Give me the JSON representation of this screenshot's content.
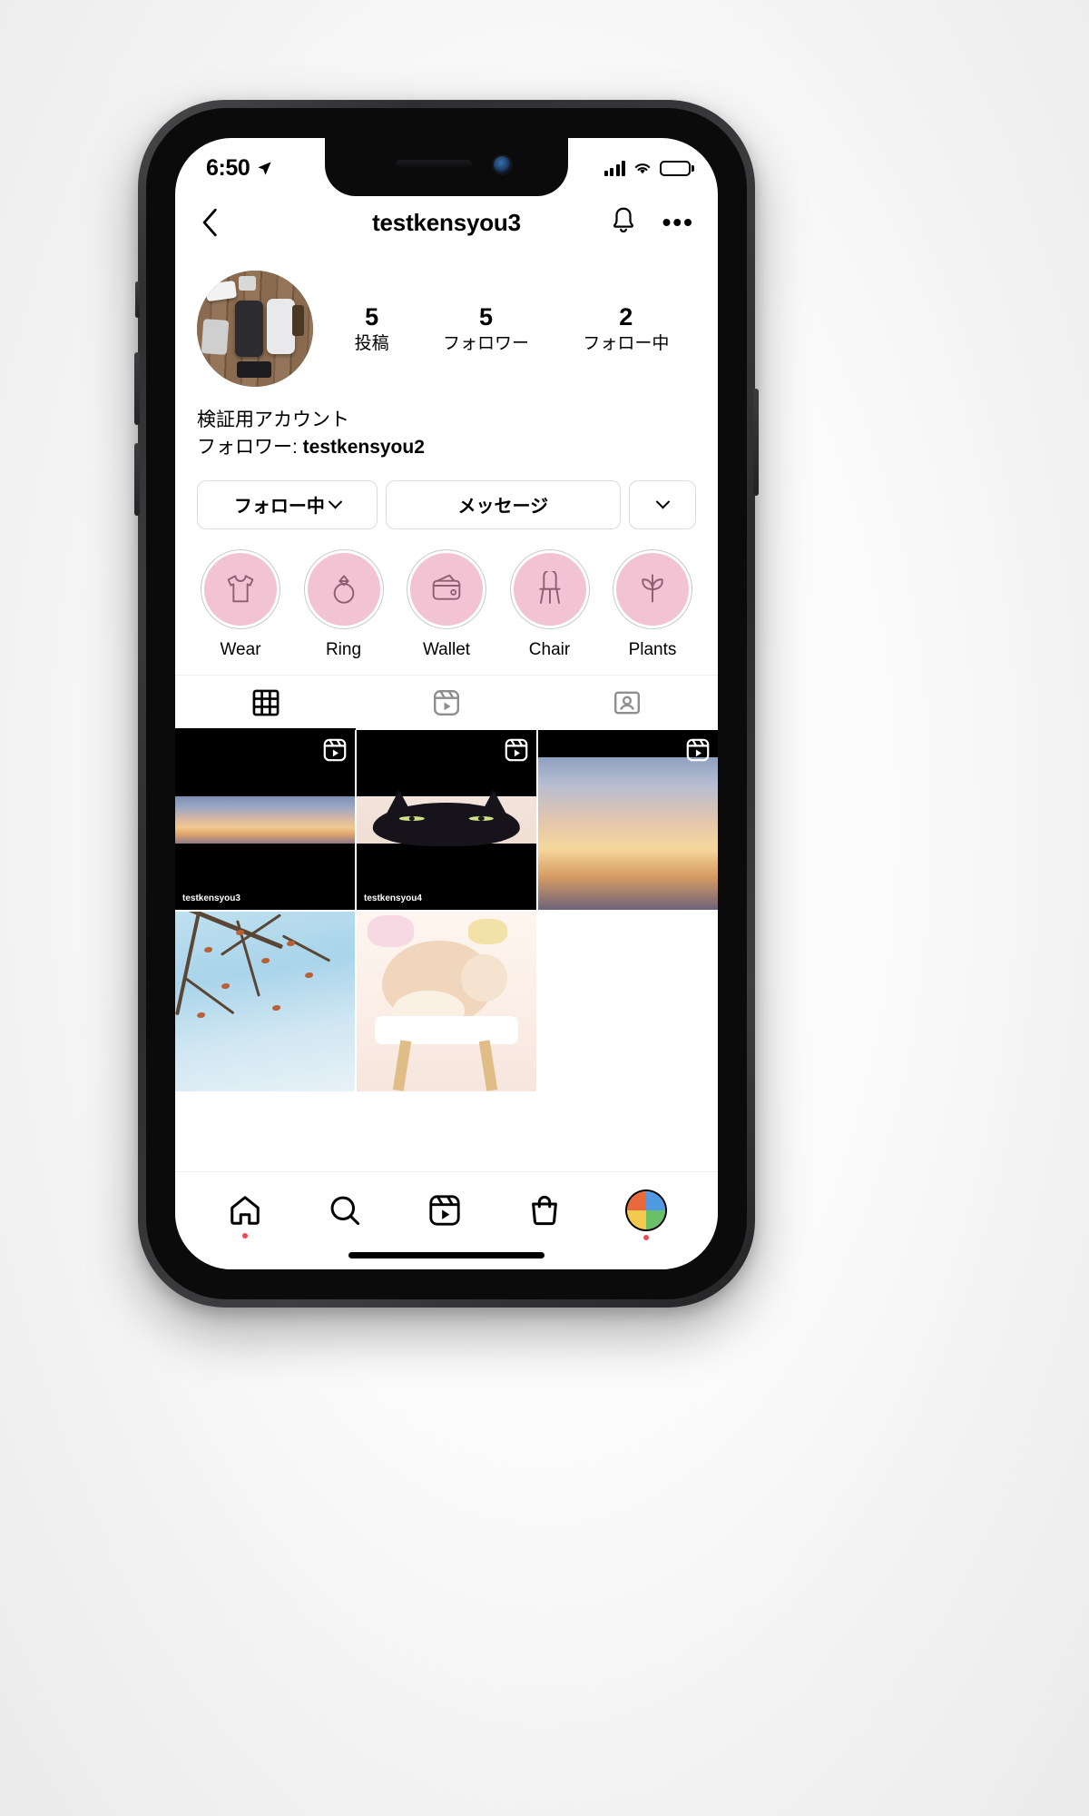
{
  "status_bar": {
    "time": "6:50",
    "location_icon": "location-arrow-icon",
    "signal_icon": "cellular-signal-icon",
    "wifi_icon": "wifi-icon",
    "battery_icon": "battery-full-icon"
  },
  "nav": {
    "back_icon": "chevron-left-icon",
    "title": "testkensyou3",
    "bell_icon": "bell-notification-icon",
    "more_label": "•••"
  },
  "profile": {
    "avatar_name": "profile-avatar",
    "stats": [
      {
        "value": "5",
        "label": "投稿"
      },
      {
        "value": "5",
        "label": "フォロワー"
      },
      {
        "value": "2",
        "label": "フォロー中"
      }
    ],
    "bio_name": "検証用アカウント",
    "followed_by_prefix": "フォロワー: ",
    "followed_by_user": "testkensyou2"
  },
  "actions": {
    "following_label": "フォロー中",
    "message_label": "メッセージ",
    "chevron_icon": "chevron-down-icon"
  },
  "highlights": [
    {
      "label": "Wear",
      "icon": "tshirt-icon"
    },
    {
      "label": "Ring",
      "icon": "ring-icon"
    },
    {
      "label": "Wallet",
      "icon": "wallet-icon"
    },
    {
      "label": "Chair",
      "icon": "chair-icon"
    },
    {
      "label": "Plants",
      "icon": "plant-icon"
    }
  ],
  "tabs": [
    {
      "name": "grid",
      "icon": "grid-icon",
      "active": true
    },
    {
      "name": "reels",
      "icon": "reels-icon",
      "active": false
    },
    {
      "name": "tagged",
      "icon": "tagged-icon",
      "active": false
    }
  ],
  "grid": [
    {
      "id": "post-1",
      "type": "reel",
      "badge": "reels-badge-icon",
      "tag": "testkensyou3",
      "art": "sunset-letterbox"
    },
    {
      "id": "post-2",
      "type": "reel",
      "badge": "reels-badge-icon",
      "tag": "testkensyou4",
      "art": "cat-letterbox"
    },
    {
      "id": "post-3",
      "type": "reel",
      "badge": "reels-badge-icon",
      "tag": "",
      "art": "sunset-full"
    },
    {
      "id": "post-4",
      "type": "photo",
      "badge": "",
      "tag": "",
      "art": "winter-branches"
    },
    {
      "id": "post-5",
      "type": "photo",
      "badge": "",
      "tag": "",
      "art": "cat-sleeping"
    }
  ],
  "bottom_nav": [
    {
      "name": "home",
      "icon": "home-icon",
      "has_dot": true
    },
    {
      "name": "search",
      "icon": "search-icon",
      "has_dot": false
    },
    {
      "name": "reels",
      "icon": "reels-icon",
      "has_dot": false
    },
    {
      "name": "shop",
      "icon": "shop-bag-icon",
      "has_dot": false
    },
    {
      "name": "profile",
      "icon": "profile-avatar-icon",
      "has_dot": true
    }
  ],
  "colors": {
    "highlight_fill": "#f2c3d3",
    "highlight_border": "#c9c9c9",
    "accent_red": "#ed4956",
    "border": "#dbdbdb"
  }
}
